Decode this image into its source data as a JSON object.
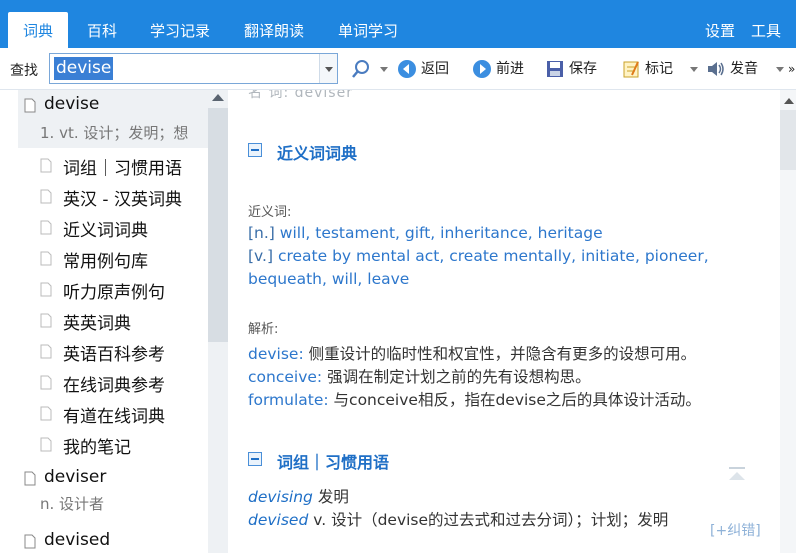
{
  "tabs": [
    {
      "label": "词典",
      "active": true
    },
    {
      "label": "百科"
    },
    {
      "label": "学习记录"
    },
    {
      "label": "翻译朗读"
    },
    {
      "label": "单词学习"
    }
  ],
  "topright": {
    "settings": "设置",
    "tools": "工具"
  },
  "toolbar": {
    "search_label": "查找",
    "search_value": "devise",
    "back": "返回",
    "forward": "前进",
    "save": "保存",
    "mark": "标记",
    "pronounce": "发音"
  },
  "left": {
    "entries": [
      {
        "word": "devise",
        "def": "1. vt. 设计；发明；想"
      },
      {
        "word": "deviser",
        "def": "n. 设计者"
      },
      {
        "word": "devised"
      }
    ],
    "subitems": [
      "词组｜习惯用语",
      "英汉 - 汉英词典",
      "近义词词典",
      "常用例句库",
      "听力原声例句",
      "英英词典",
      "英语百科参考",
      "在线词典参考",
      "有道在线词典",
      "我的笔记"
    ]
  },
  "content": {
    "faded_top": "名 词: deviser",
    "sec1_title": "近义词词典",
    "syn_label": "近义词:",
    "syn": [
      {
        "pos": "[n.]",
        "words": "will, testament, gift, inheritance, heritage"
      },
      {
        "pos": "[v.]",
        "words": "create by mental act, create mentally, initiate, pioneer,"
      },
      {
        "pos": "",
        "words": "bequeath, will, leave"
      }
    ],
    "analysis_label": "解析:",
    "analysis": [
      {
        "w": "devise:",
        "t": "侧重设计的临时性和权宜性，并隐含有更多的设想可用。"
      },
      {
        "w": "conceive:",
        "t": "强调在制定计划之前的先有设想构思。"
      },
      {
        "w": "formulate:",
        "t": "与conceive相反，指在devise之后的具体设计活动。"
      }
    ],
    "sec2_title": "词组｜习惯用语",
    "phrases": [
      {
        "w": "devising",
        "t": "发明"
      },
      {
        "w": "devised",
        "t": "v. 设计（devise的过去式和过去分词）；计划；发明"
      }
    ],
    "correct_link": "[+纠错]"
  },
  "colors": {
    "accent": "#1f86e0",
    "link": "#2d77cc",
    "heading": "#1f6fc6"
  }
}
